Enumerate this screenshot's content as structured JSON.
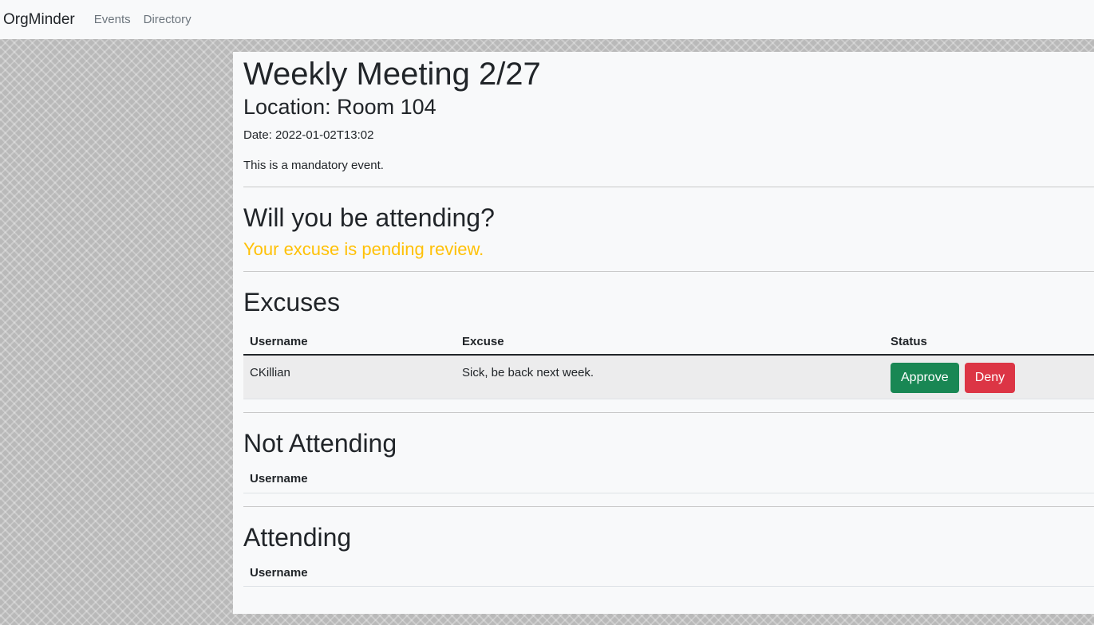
{
  "nav": {
    "brand": "OrgMinder",
    "links": [
      "Events",
      "Directory"
    ]
  },
  "event": {
    "title": "Weekly Meeting 2/27",
    "location": "Location: Room 104",
    "date": "Date: 2022-01-02T13:02",
    "description": "This is a mandatory event."
  },
  "attendance": {
    "heading": "Will you be attending?",
    "status_message": "Your excuse is pending review."
  },
  "excuses": {
    "heading": "Excuses",
    "columns": [
      "Username",
      "Excuse",
      "Status"
    ],
    "rows": [
      {
        "username": "CKillian",
        "excuse": "Sick, be back next week.",
        "approve_label": "Approve",
        "deny_label": "Deny"
      }
    ]
  },
  "not_attending": {
    "heading": "Not Attending",
    "columns": [
      "Username"
    ],
    "rows": []
  },
  "attending": {
    "heading": "Attending",
    "columns": [
      "Username"
    ],
    "rows": []
  },
  "colors": {
    "pending": "#ffc107",
    "approve": "#198754",
    "deny": "#dc3545"
  }
}
